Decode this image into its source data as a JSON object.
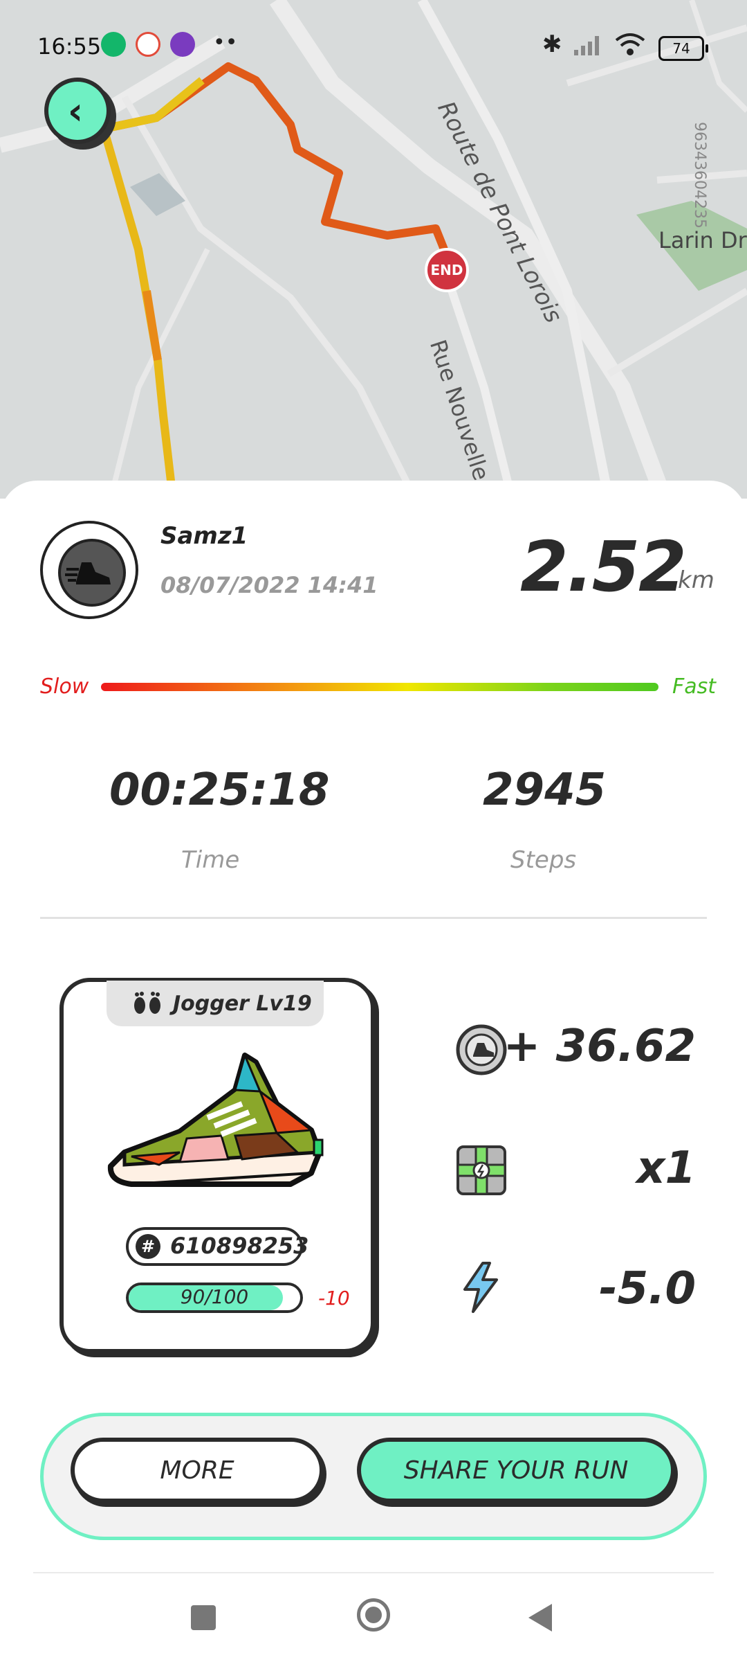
{
  "status_bar": {
    "time": "16:55",
    "battery": "74"
  },
  "map": {
    "street_labels": [
      "Route de Pont Lorois",
      "Rue Nouvelle",
      "Larin Dr",
      "96343604235"
    ],
    "end_marker": "END"
  },
  "run": {
    "username": "Samz1",
    "datetime": "08/07/2022 14:41",
    "distance": "2.52",
    "distance_unit": "km",
    "speed_scale": {
      "slow": "Slow",
      "fast": "Fast"
    },
    "time_value": "00:25:18",
    "time_label": "Time",
    "steps_value": "2945",
    "steps_label": "Steps"
  },
  "sneaker": {
    "level": "Jogger Lv19",
    "id": "610898253",
    "durability_text": "90/100",
    "durability_fraction": 0.9,
    "durability_delta": "-10"
  },
  "rewards": [
    {
      "icon": "gst-token-icon",
      "value": "+ 36.62"
    },
    {
      "icon": "mystery-box-icon",
      "value": "x1"
    },
    {
      "icon": "energy-bolt-icon",
      "value": "-5.0"
    }
  ],
  "actions": {
    "more": "MORE",
    "share": "SHARE YOUR RUN"
  },
  "colors": {
    "accent": "#6ff0c3",
    "slow": "#e21d1d",
    "fast": "#44bb22",
    "dark": "#2b2b2b"
  }
}
